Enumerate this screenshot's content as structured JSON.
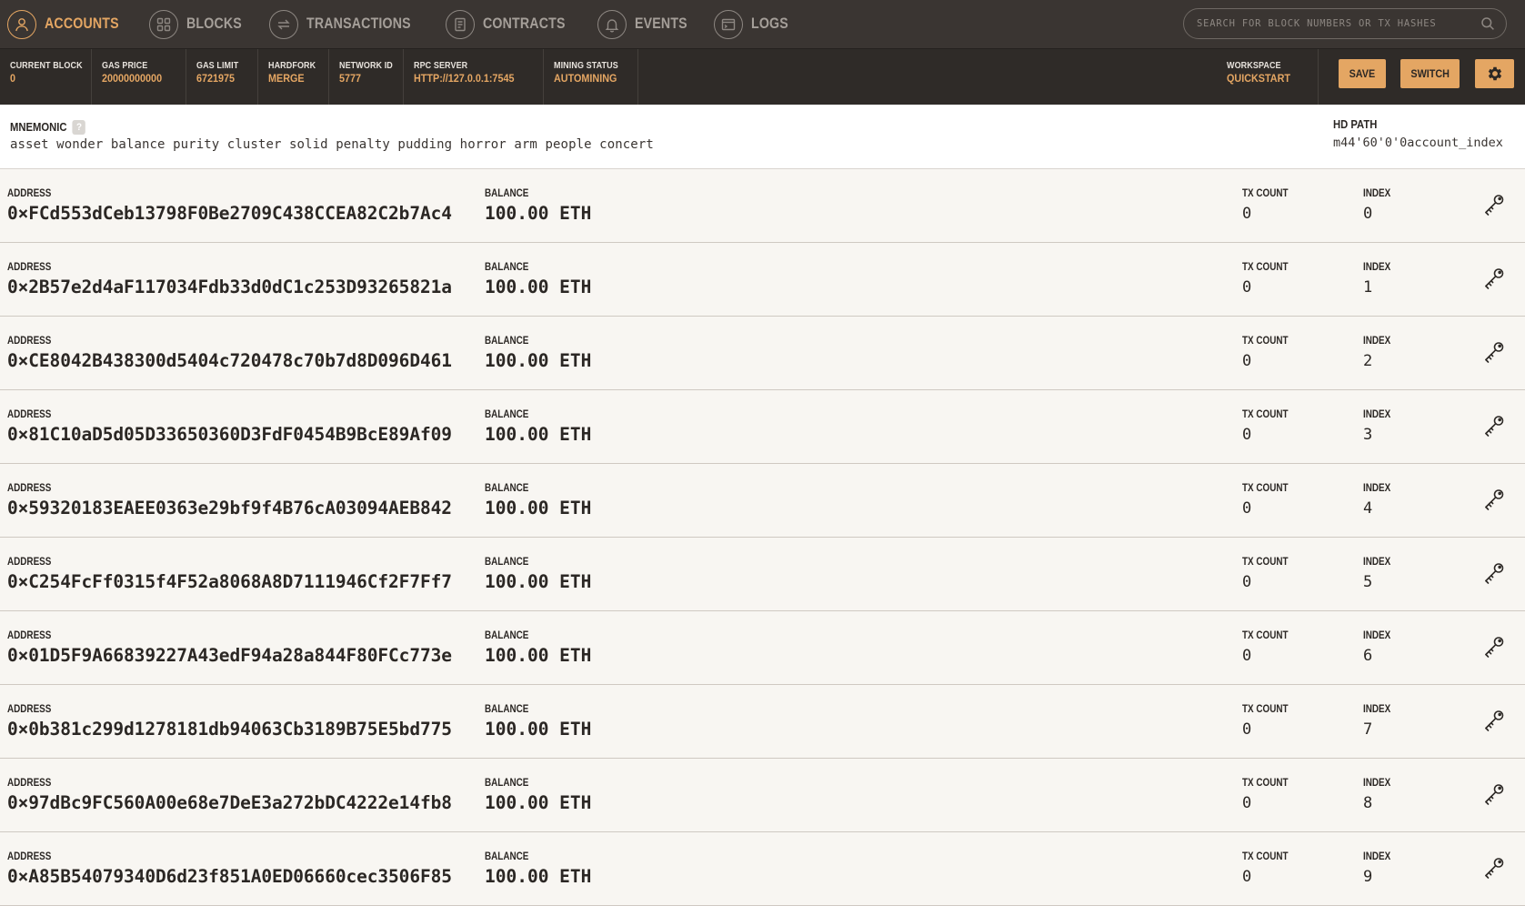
{
  "nav": {
    "items": [
      {
        "label": "ACCOUNTS",
        "icon": "user-icon",
        "active": true
      },
      {
        "label": "BLOCKS",
        "icon": "blocks-grid-icon",
        "active": false
      },
      {
        "label": "TRANSACTIONS",
        "icon": "swap-arrows-icon",
        "active": false
      },
      {
        "label": "CONTRACTS",
        "icon": "document-icon",
        "active": false
      },
      {
        "label": "EVENTS",
        "icon": "bell-icon",
        "active": false
      },
      {
        "label": "LOGS",
        "icon": "terminal-window-icon",
        "active": false
      }
    ],
    "search_placeholder": "SEARCH FOR BLOCK NUMBERS OR TX HASHES"
  },
  "status": {
    "current_block": {
      "label": "CURRENT BLOCK",
      "value": "0"
    },
    "gas_price": {
      "label": "GAS PRICE",
      "value": "20000000000"
    },
    "gas_limit": {
      "label": "GAS LIMIT",
      "value": "6721975"
    },
    "hardfork": {
      "label": "HARDFORK",
      "value": "MERGE"
    },
    "network_id": {
      "label": "NETWORK ID",
      "value": "5777"
    },
    "rpc_server": {
      "label": "RPC SERVER",
      "value": "HTTP://127.0.0.1:7545"
    },
    "mining_status": {
      "label": "MINING STATUS",
      "value": "AUTOMINING"
    },
    "workspace": {
      "label": "WORKSPACE",
      "value": "QUICKSTART"
    },
    "save_label": "SAVE",
    "switch_label": "SWITCH"
  },
  "mnemonic": {
    "label": "MNEMONIC",
    "help": "?",
    "words": "asset wonder balance purity cluster solid penalty pudding horror arm people concert",
    "hd_path_label": "HD PATH",
    "hd_path": "m44'60'0'0account_index"
  },
  "columns": {
    "address": "ADDRESS",
    "balance": "BALANCE",
    "tx_count": "TX COUNT",
    "index": "INDEX"
  },
  "accounts": [
    {
      "address": "0×FCd553dCeb13798F0Be2709C438CCEA82C2b7Ac4",
      "balance": "100.00 ETH",
      "tx_count": "0",
      "index": "0"
    },
    {
      "address": "0×2B57e2d4aF117034Fdb33d0dC1c253D93265821a",
      "balance": "100.00 ETH",
      "tx_count": "0",
      "index": "1"
    },
    {
      "address": "0×CE8042B438300d5404c720478c70b7d8D096D461",
      "balance": "100.00 ETH",
      "tx_count": "0",
      "index": "2"
    },
    {
      "address": "0×81C10aD5d05D33650360D3FdF0454B9BcE89Af09",
      "balance": "100.00 ETH",
      "tx_count": "0",
      "index": "3"
    },
    {
      "address": "0×59320183EAEE0363e29bf9f4B76cA03094AEB842",
      "balance": "100.00 ETH",
      "tx_count": "0",
      "index": "4"
    },
    {
      "address": "0×C254FcFf0315f4F52a8068A8D7111946Cf2F7Ff7",
      "balance": "100.00 ETH",
      "tx_count": "0",
      "index": "5"
    },
    {
      "address": "0×01D5F9A66839227A43edF94a28a844F80FCc773e",
      "balance": "100.00 ETH",
      "tx_count": "0",
      "index": "6"
    },
    {
      "address": "0×0b381c299d1278181db94063Cb3189B75E5bd775",
      "balance": "100.00 ETH",
      "tx_count": "0",
      "index": "7"
    },
    {
      "address": "0×97dBc9FC560A00e68e7DeE3a272bDC4222e14fb8",
      "balance": "100.00 ETH",
      "tx_count": "0",
      "index": "8"
    },
    {
      "address": "0×A85B54079340D6d23f851A0ED06660cec3506F85",
      "balance": "100.00 ETH",
      "tx_count": "0",
      "index": "9"
    }
  ],
  "colors": {
    "accent": "#e4a663",
    "nav_bg": "#3a3532",
    "status_bg": "#2f2b28",
    "page_bg": "#f8f6f2"
  }
}
